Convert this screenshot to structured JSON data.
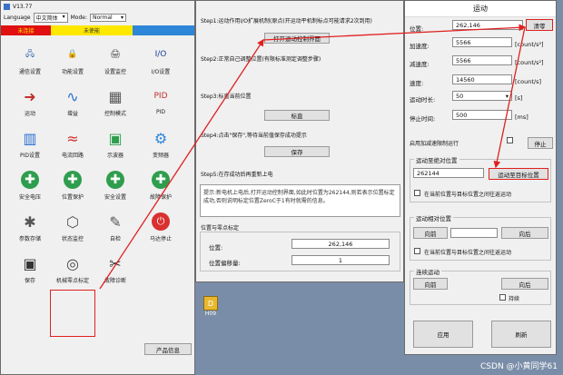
{
  "desktop": {
    "taskbar_label": "H09",
    "watermark": "CSDN @小黄同学61"
  },
  "main_window": {
    "title": "V13.77",
    "language_label": "Language",
    "language_value": "中文简体",
    "mode_label": "Mode:",
    "mode_value": "Normal",
    "status_left": "未连接",
    "status_mid": "未使能",
    "icons": [
      {
        "label": "通信设置",
        "icon": "network-icon"
      },
      {
        "label": "功能设置",
        "icon": "lock-icon"
      },
      {
        "label": "设置监控",
        "icon": "printer-icon"
      },
      {
        "label": "I/O设置",
        "icon": "io-icon"
      },
      {
        "label": "运动",
        "icon": "motion-icon"
      },
      {
        "label": "增益",
        "icon": "wave-icon"
      },
      {
        "label": "控制模式",
        "icon": "control-icon"
      },
      {
        "label": "PID",
        "icon": "pid-icon"
      },
      {
        "label": "PID设置",
        "icon": "pid-set-icon"
      },
      {
        "label": "电流回路",
        "icon": "current-icon"
      },
      {
        "label": "示波器",
        "icon": "scope-icon"
      },
      {
        "label": "变频器",
        "icon": "gear-icon"
      },
      {
        "label": "安全电压",
        "icon": "safe-icon"
      },
      {
        "label": "位置保护",
        "icon": "pos-protect-icon"
      },
      {
        "label": "安全设置",
        "icon": "safe-set-icon"
      },
      {
        "label": "故障保护",
        "icon": "fault-icon"
      },
      {
        "label": "参数存储",
        "icon": "store-icon"
      },
      {
        "label": "状态监控",
        "icon": "monitor-icon"
      },
      {
        "label": "自检",
        "icon": "selfcheck-icon"
      },
      {
        "label": "马达停止",
        "icon": "power-icon"
      },
      {
        "label": "保存",
        "icon": "save-icon"
      },
      {
        "label": "机械零点标定",
        "icon": "location-icon"
      },
      {
        "label": "故障诊断",
        "icon": "tools-icon"
      }
    ],
    "product_info_button": "产品信息"
  },
  "calib_window": {
    "step1": "Step1:运动作用I/O扩展机制(原点(开运动平机制标点可能请求2次到用)",
    "step1_button": "打开运动控制界面",
    "step2": "Step2:正常自己调整位置(有限标准测定调整步骤)",
    "step3": "Step3:标直当前位置",
    "step3_button": "标直",
    "step4": "Step4:点击\"保存\",等待当前值保存成功提示",
    "step4_button": "保存",
    "step5": "Step5:在存成功后再重新上电",
    "hint": "提示:新电机上电后,打开运动控制界面,如此时位置为262144,则若表示位置标定成功,否则说明标定位置ZeroC于1有时就需的信息。",
    "pos_group_title": "位置与零点标定",
    "position_label": "位置:",
    "position_value": "262,146",
    "offset_label": "位置偏移量:",
    "offset_value": "1"
  },
  "motion_window": {
    "title": "运动",
    "position_label": "位置:",
    "position_value": "262,146",
    "clear_button": "清零",
    "accel_label": "加速度:",
    "accel_value": "5566",
    "accel_unit": "[count/s²]",
    "decel_label": "减速度:",
    "decel_value": "5566",
    "decel_unit": "[count/s²]",
    "speed_label": "速度:",
    "speed_value": "14560",
    "speed_unit": "[count/s]",
    "time_label": "运动时长:",
    "time_value": "50",
    "time_unit": "[s]",
    "pause_label": "停止时间:",
    "pause_value": "500",
    "pause_unit": "[ms]",
    "stop_check_label": "启用加减速限制运行",
    "stop_button": "停止",
    "abs_group_title": "运动至绝对位置",
    "abs_value": "262144",
    "abs_button": "运动至目标位置",
    "abs_check_label": "在当前位置与目标位置之间往返运动",
    "rel_group_title": "运动相对位置",
    "rel_fwd_button": "向前",
    "rel_back_button": "向后",
    "rel_check_label": "在当前位置与目标位置之间往返运动",
    "jog_group_title": "连续运动",
    "jog_fwd_button": "向前",
    "jog_back_button": "向后",
    "jog_check_label": "持续",
    "apply_button": "应用",
    "refresh_button": "刷新"
  }
}
